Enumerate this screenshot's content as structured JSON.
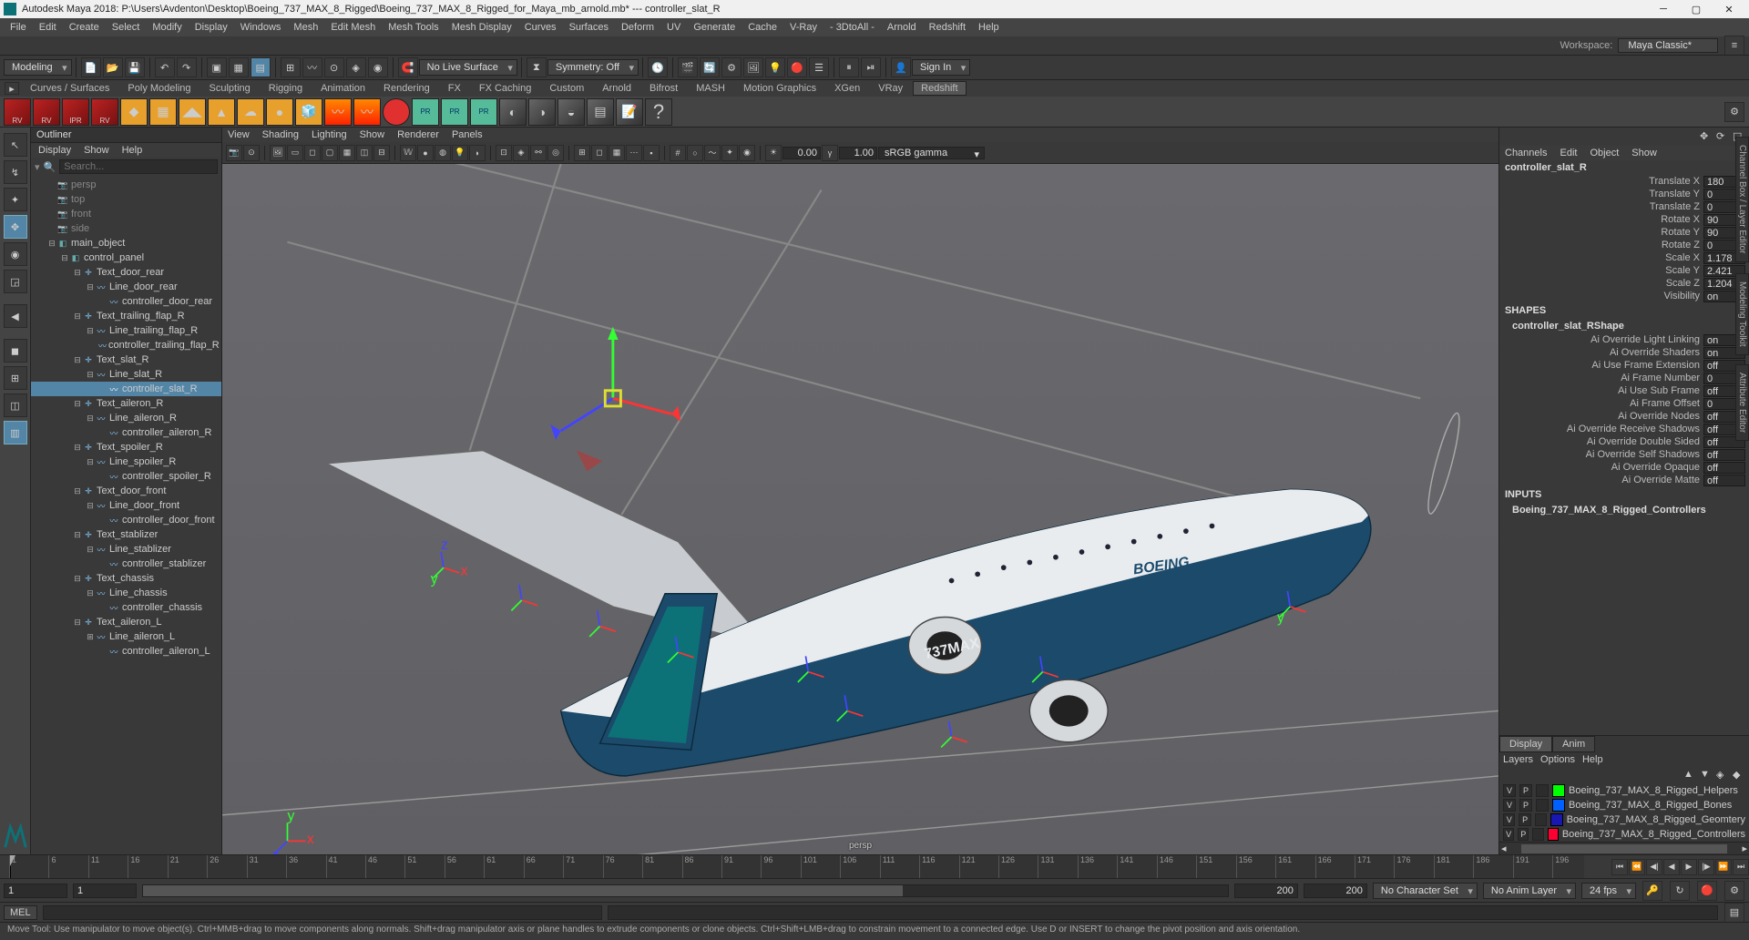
{
  "window": {
    "title": "Autodesk Maya 2018: P:\\Users\\Avdenton\\Desktop\\Boeing_737_MAX_8_Rigged\\Boeing_737_MAX_8_Rigged_for_Maya_mb_arnold.mb*   ---   controller_slat_R"
  },
  "main_menu": [
    "File",
    "Edit",
    "Create",
    "Select",
    "Modify",
    "Display",
    "Windows",
    "Mesh",
    "Edit Mesh",
    "Mesh Tools",
    "Mesh Display",
    "Curves",
    "Surfaces",
    "Deform",
    "UV",
    "Generate",
    "Cache",
    "V-Ray",
    "- 3DtoAll -",
    "Arnold",
    "Redshift",
    "Help"
  ],
  "workspace": {
    "label": "Workspace:",
    "value": "Maya Classic*"
  },
  "mode_dropdown": "Modeling",
  "status_bar": {
    "live_surface": "No Live Surface",
    "symmetry": "Symmetry: Off",
    "signin": "Sign In"
  },
  "shelf_tabs": [
    "Curves / Surfaces",
    "Poly Modeling",
    "Sculpting",
    "Rigging",
    "Animation",
    "Rendering",
    "FX",
    "FX Caching",
    "Custom",
    "Arnold",
    "Bifrost",
    "MASH",
    "Motion Graphics",
    "XGen",
    "VRay",
    "Redshift"
  ],
  "shelf_active": "Redshift",
  "shelf_rv_labels": [
    "RV",
    "RV",
    "IPR",
    "RV"
  ],
  "outliner": {
    "title": "Outliner",
    "menu": [
      "Display",
      "Show",
      "Help"
    ],
    "search_placeholder": "Search...",
    "cams": [
      "persp",
      "top",
      "front",
      "side"
    ],
    "tree": [
      {
        "d": 0,
        "t": "main_object",
        "ic": "grp",
        "exp": "-"
      },
      {
        "d": 1,
        "t": "control_panel",
        "ic": "grp",
        "exp": "-"
      },
      {
        "d": 2,
        "t": "Text_door_rear",
        "ic": "xform",
        "exp": "-"
      },
      {
        "d": 3,
        "t": "Line_door_rear",
        "ic": "curve",
        "exp": "-"
      },
      {
        "d": 4,
        "t": "controller_door_rear",
        "ic": "curve",
        "exp": ""
      },
      {
        "d": 2,
        "t": "Text_trailing_flap_R",
        "ic": "xform",
        "exp": "-"
      },
      {
        "d": 3,
        "t": "Line_trailing_flap_R",
        "ic": "curve",
        "exp": "-"
      },
      {
        "d": 4,
        "t": "controller_trailing_flap_R",
        "ic": "curve",
        "exp": ""
      },
      {
        "d": 2,
        "t": "Text_slat_R",
        "ic": "xform",
        "exp": "-"
      },
      {
        "d": 3,
        "t": "Line_slat_R",
        "ic": "curve",
        "exp": "-"
      },
      {
        "d": 4,
        "t": "controller_slat_R",
        "ic": "curve",
        "exp": "",
        "sel": true
      },
      {
        "d": 2,
        "t": "Text_aileron_R",
        "ic": "xform",
        "exp": "-"
      },
      {
        "d": 3,
        "t": "Line_aileron_R",
        "ic": "curve",
        "exp": "-"
      },
      {
        "d": 4,
        "t": "controller_aileron_R",
        "ic": "curve",
        "exp": ""
      },
      {
        "d": 2,
        "t": "Text_spoiler_R",
        "ic": "xform",
        "exp": "-"
      },
      {
        "d": 3,
        "t": "Line_spoiler_R",
        "ic": "curve",
        "exp": "-"
      },
      {
        "d": 4,
        "t": "controller_spoiler_R",
        "ic": "curve",
        "exp": ""
      },
      {
        "d": 2,
        "t": "Text_door_front",
        "ic": "xform",
        "exp": "-"
      },
      {
        "d": 3,
        "t": "Line_door_front",
        "ic": "curve",
        "exp": "-"
      },
      {
        "d": 4,
        "t": "controller_door_front",
        "ic": "curve",
        "exp": ""
      },
      {
        "d": 2,
        "t": "Text_stablizer",
        "ic": "xform",
        "exp": "-"
      },
      {
        "d": 3,
        "t": "Line_stablizer",
        "ic": "curve",
        "exp": "-"
      },
      {
        "d": 4,
        "t": "controller_stablizer",
        "ic": "curve",
        "exp": ""
      },
      {
        "d": 2,
        "t": "Text_chassis",
        "ic": "xform",
        "exp": "-"
      },
      {
        "d": 3,
        "t": "Line_chassis",
        "ic": "curve",
        "exp": "-"
      },
      {
        "d": 4,
        "t": "controller_chassis",
        "ic": "curve",
        "exp": ""
      },
      {
        "d": 2,
        "t": "Text_aileron_L",
        "ic": "xform",
        "exp": "-"
      },
      {
        "d": 3,
        "t": "Line_aileron_L",
        "ic": "curve",
        "exp": "+"
      },
      {
        "d": 4,
        "t": "controller_aileron_L",
        "ic": "curve",
        "exp": ""
      }
    ]
  },
  "viewport": {
    "menu": [
      "View",
      "Shading",
      "Lighting",
      "Show",
      "Renderer",
      "Panels"
    ],
    "near": "0.00",
    "far": "1.00",
    "gamma": "sRGB gamma",
    "camera": "persp"
  },
  "channel_box": {
    "menu": [
      "Channels",
      "Edit",
      "Object",
      "Show"
    ],
    "object": "controller_slat_R",
    "attrs": [
      {
        "n": "Translate X",
        "v": "180"
      },
      {
        "n": "Translate Y",
        "v": "0"
      },
      {
        "n": "Translate Z",
        "v": "0"
      },
      {
        "n": "Rotate X",
        "v": "90"
      },
      {
        "n": "Rotate Y",
        "v": "90"
      },
      {
        "n": "Rotate Z",
        "v": "0"
      },
      {
        "n": "Scale X",
        "v": "1.178"
      },
      {
        "n": "Scale Y",
        "v": "2.421"
      },
      {
        "n": "Scale Z",
        "v": "1.204"
      },
      {
        "n": "Visibility",
        "v": "on"
      }
    ],
    "shapes_head": "SHAPES",
    "shape_name": "controller_slat_RShape",
    "shape_attrs": [
      {
        "n": "Ai Override Light Linking",
        "v": "on"
      },
      {
        "n": "Ai Override Shaders",
        "v": "on"
      },
      {
        "n": "Ai Use Frame Extension",
        "v": "off"
      },
      {
        "n": "Ai Frame Number",
        "v": "0"
      },
      {
        "n": "Ai Use Sub Frame",
        "v": "off"
      },
      {
        "n": "Ai Frame Offset",
        "v": "0"
      },
      {
        "n": "Ai Override Nodes",
        "v": "off"
      },
      {
        "n": "Ai Override Receive Shadows",
        "v": "off"
      },
      {
        "n": "Ai Override Double Sided",
        "v": "off"
      },
      {
        "n": "Ai Override Self Shadows",
        "v": "off"
      },
      {
        "n": "Ai Override Opaque",
        "v": "off"
      },
      {
        "n": "Ai Override Matte",
        "v": "off"
      }
    ],
    "inputs_head": "INPUTS",
    "input_name": "Boeing_737_MAX_8_Rigged_Controllers"
  },
  "layers": {
    "tabs": [
      "Display",
      "Anim"
    ],
    "menu": [
      "Layers",
      "Options",
      "Help"
    ],
    "items": [
      {
        "c": "#00ff00",
        "n": "Boeing_737_MAX_8_Rigged_Helpers"
      },
      {
        "c": "#0060ff",
        "n": "Boeing_737_MAX_8_Rigged_Bones"
      },
      {
        "c": "#1818b0",
        "n": "Boeing_737_MAX_8_Rigged_Geomtery"
      },
      {
        "c": "#ff0033",
        "n": "Boeing_737_MAX_8_Rigged_Controllers"
      }
    ],
    "vis": "V",
    "playback": "P"
  },
  "range": {
    "start": "1",
    "in": "1",
    "out": "200",
    "end": "200",
    "char": "No Character Set",
    "anim": "No Anim Layer",
    "fps": "24 fps"
  },
  "cmd": {
    "lang": "MEL"
  },
  "help": "Move Tool: Use manipulator to move object(s). Ctrl+MMB+drag to move components along normals. Shift+drag manipulator axis or plane handles to extrude components or clone objects. Ctrl+Shift+LMB+drag to constrain movement to a connected edge. Use D or INSERT to change the pivot position and axis orientation.",
  "side_tabs": [
    "Channel Box / Layer Editor",
    "Modeling Toolkit",
    "Attribute Editor"
  ]
}
